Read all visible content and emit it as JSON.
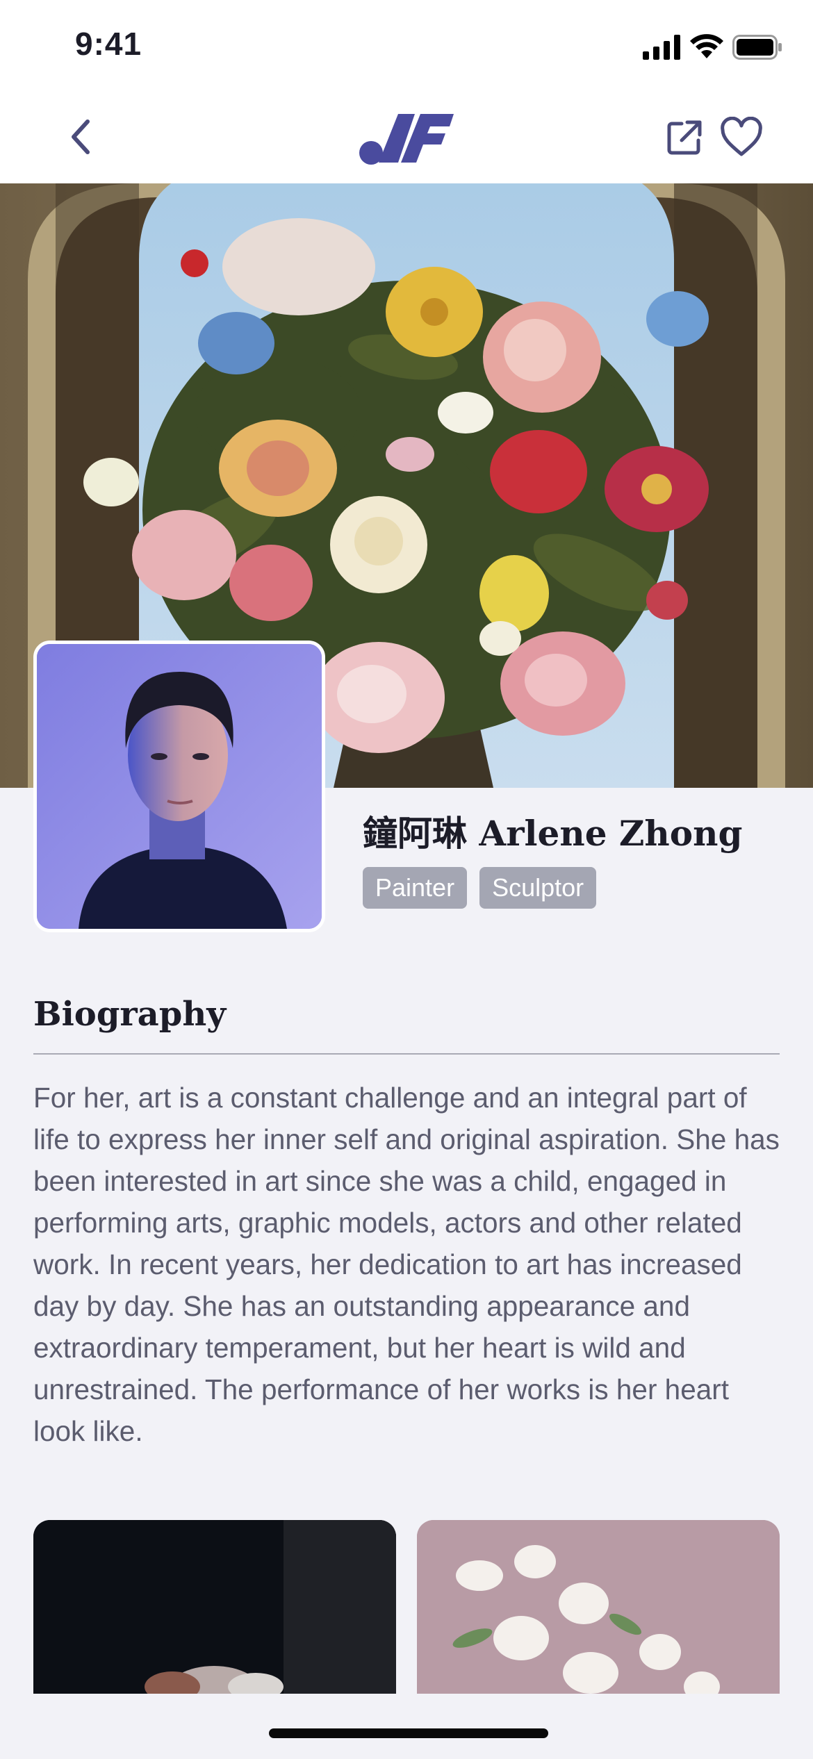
{
  "status_bar": {
    "time": "9:41"
  },
  "nav": {
    "back_icon": "chevron-left-icon",
    "logo_icon": "brand-logo",
    "share_icon": "share-external-icon",
    "favorite_icon": "heart-icon",
    "accent_color": "#4a4b9e"
  },
  "artist": {
    "name": "鐘阿琳 Arlene Zhong",
    "tags": [
      "Painter",
      "Sculptor"
    ]
  },
  "biography": {
    "title": "Biography",
    "text": "For her, art is a constant challenge and an integral part of life to express her inner self and original aspiration. She has been interested in art since she was a child, engaged in performing arts, graphic models, actors and other related work. In recent years, her dedication to art has increased day by day. She has an outstanding appearance and extraordinary temperament, but her heart is wild and unrestrained. The performance of her works is her heart look like."
  }
}
